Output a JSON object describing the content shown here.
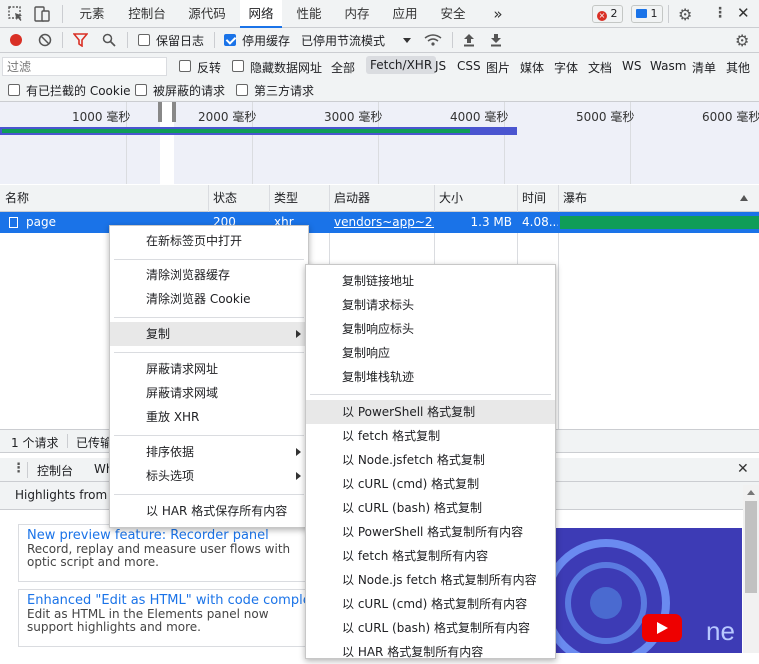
{
  "tabs": [
    "元素",
    "控制台",
    "源代码",
    "网络",
    "性能",
    "内存",
    "应用",
    "安全"
  ],
  "more_tabs": "»",
  "badges": {
    "errors": "2",
    "messages": "1"
  },
  "toolbar": {
    "preserve_log": "保留日志",
    "disable_cache": "停用缓存",
    "throttling": "已停用节流模式"
  },
  "filter": {
    "placeholder": "过滤",
    "invert": "反转",
    "hide_data_urls": "隐藏数据网址",
    "types": [
      "全部",
      "Fetch/XHR",
      "JS",
      "CSS",
      "图片",
      "媒体",
      "字体",
      "文档",
      "WS",
      "Wasm",
      "清单",
      "其他"
    ],
    "active_type": "Fetch/XHR",
    "blocked_cookies": "有已拦截的 Cookie",
    "blocked_requests": "被屏蔽的请求",
    "third_party": "第三方请求"
  },
  "overview": {
    "ticks": [
      "1000 毫秒",
      "2000 毫秒",
      "3000 毫秒",
      "4000 毫秒",
      "5000 毫秒",
      "6000 毫秒"
    ]
  },
  "table": {
    "headers": [
      "名称",
      "状态",
      "类型",
      "启动器",
      "大小",
      "时间",
      "瀑布"
    ],
    "row": {
      "name": "page",
      "status": "200",
      "type": "xhr",
      "initiator": "vendors~app~2...",
      "size": "1.3 MB",
      "time": "4.08..."
    }
  },
  "status_bar": {
    "requests": "1 个请求",
    "transferred": "已传输"
  },
  "drawer": {
    "console_tab": "控制台",
    "whats_new_tab": "Wh",
    "highlights": "Highlights from th",
    "cards": [
      {
        "title": "New preview feature: Recorder panel",
        "desc": "Record, replay and measure user flows with optic script and more."
      },
      {
        "title": "Enhanced \"Edit as HTML\" with code completi",
        "desc": "Edit as HTML in the Elements panel now support highlights and more."
      }
    ]
  },
  "context_menu": {
    "items": [
      "在新标签页中打开",
      "清除浏览器缓存",
      "清除浏览器 Cookie",
      "复制",
      "屏蔽请求网址",
      "屏蔽请求网域",
      "重放 XHR",
      "排序依据",
      "标头选项",
      "以 HAR 格式保存所有内容"
    ]
  },
  "copy_submenu": {
    "items": [
      "复制链接地址",
      "复制请求标头",
      "复制响应标头",
      "复制响应",
      "复制堆栈轨迹",
      "以 PowerShell 格式复制",
      "以 fetch 格式复制",
      "以 Node.jsfetch 格式复制",
      "以 cURL (cmd) 格式复制",
      "以 cURL (bash) 格式复制",
      "以 PowerShell 格式复制所有内容",
      "以 fetch 格式复制所有内容",
      "以 Node.js fetch 格式复制所有内容",
      "以 cURL (cmd) 格式复制所有内容",
      "以 cURL (bash) 格式复制所有内容",
      "以 HAR 格式复制所有内容"
    ]
  },
  "colors": {
    "accent": "#1a73e8",
    "record": "#d93025",
    "waterfall_green": "#0f9d58"
  }
}
